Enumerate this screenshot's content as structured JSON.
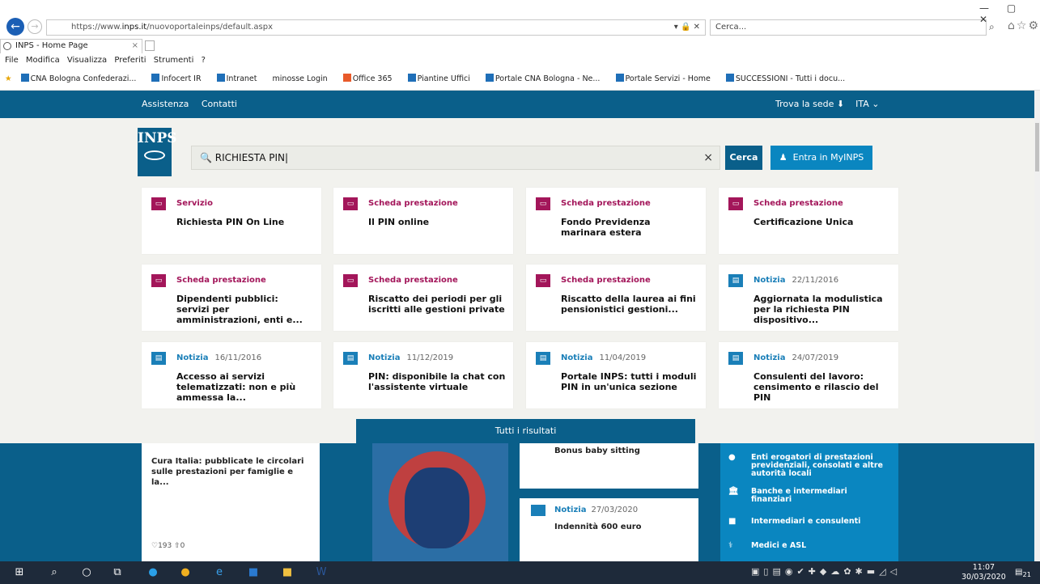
{
  "browser": {
    "url_prefix": "https://www.",
    "url_domain": "inps.it",
    "url_path": "/nuovoportaleinps/default.aspx",
    "addr_icons": "▾ 🔒 ✕",
    "search_placeholder": "Cerca...",
    "tab_title": "INPS - Home Page",
    "tab_close": "×",
    "window_controls": "—  ▢  ✕"
  },
  "menubar": [
    "File",
    "Modifica",
    "Visualizza",
    "Preferiti",
    "Strumenti",
    "?"
  ],
  "favorites": [
    "CNA Bologna Confederazi...",
    "Infocert IR",
    "Intranet",
    "minosse Login",
    "Office 365",
    "Piantine Uffici",
    "Portale CNA Bologna - Ne...",
    "Portale Servizi - Home",
    "SUCCESSIONI - Tutti i docu..."
  ],
  "nav": {
    "assistenza": "Assistenza",
    "contatti": "Contatti",
    "trova_sede": "Trova la sede",
    "lang": "ITA"
  },
  "header": {
    "logo_text": "INPS",
    "search_value": "RICHIESTA PIN",
    "clear": "×",
    "cerca": "Cerca",
    "myinps": "Entra in MyINPS"
  },
  "results": [
    {
      "type": "svc",
      "category": "Servizio",
      "date": "",
      "title": "Richiesta PIN On Line"
    },
    {
      "type": "svc",
      "category": "Scheda prestazione",
      "date": "",
      "title": "Il PIN online"
    },
    {
      "type": "svc",
      "category": "Scheda prestazione",
      "date": "",
      "title": "Fondo Previdenza marinara estera"
    },
    {
      "type": "svc",
      "category": "Scheda prestazione",
      "date": "",
      "title": "Certificazione Unica"
    },
    {
      "type": "svc",
      "category": "Scheda prestazione",
      "date": "",
      "title": "Dipendenti pubblici: servizi per amministrazioni, enti e..."
    },
    {
      "type": "svc",
      "category": "Scheda prestazione",
      "date": "",
      "title": "Riscatto dei periodi per gli iscritti alle gestioni private"
    },
    {
      "type": "svc",
      "category": "Scheda prestazione",
      "date": "",
      "title": "Riscatto della laurea ai fini pensionistici gestioni..."
    },
    {
      "type": "nws",
      "category": "Notizia",
      "date": "22/11/2016",
      "title": "Aggiornata la modulistica per la richiesta PIN dispositivo..."
    },
    {
      "type": "nws",
      "category": "Notizia",
      "date": "16/11/2016",
      "title": "Accesso ai servizi telematizzati: non e più ammessa la..."
    },
    {
      "type": "nws",
      "category": "Notizia",
      "date": "11/12/2019",
      "title": "PIN: disponibile la chat con l'assistente virtuale"
    },
    {
      "type": "nws",
      "category": "Notizia",
      "date": "11/04/2019",
      "title": "Portale INPS: tutti i moduli PIN in un'unica sezione"
    },
    {
      "type": "nws",
      "category": "Notizia",
      "date": "24/07/2019",
      "title": "Consulenti del lavoro: censimento e rilascio del PIN"
    }
  ],
  "all_results": "Tutti i risultati",
  "underlying": {
    "card1_title": "Cura Italia: pubblicate le circolari sulle prestazioni per famiglie e la...",
    "card1_stats": "♡193  ⇧0",
    "card2_title": "Bonus baby sitting",
    "card3_category": "Notizia",
    "card3_date": "27/03/2020",
    "card3_title": "Indennità 600 euro",
    "side_items": [
      "Enti erogatori di prestazioni previdenziali, consolati e altre autorità locali",
      "Banche e intermediari finanziari",
      "Intermediari e consulenti",
      "Medici e ASL"
    ]
  },
  "taskbar": {
    "time": "11:07",
    "date": "30/03/2020",
    "notif": "21"
  },
  "colors": {
    "brand": "#0a5f8a",
    "service": "#a3165a",
    "news": "#1a7fb8"
  }
}
